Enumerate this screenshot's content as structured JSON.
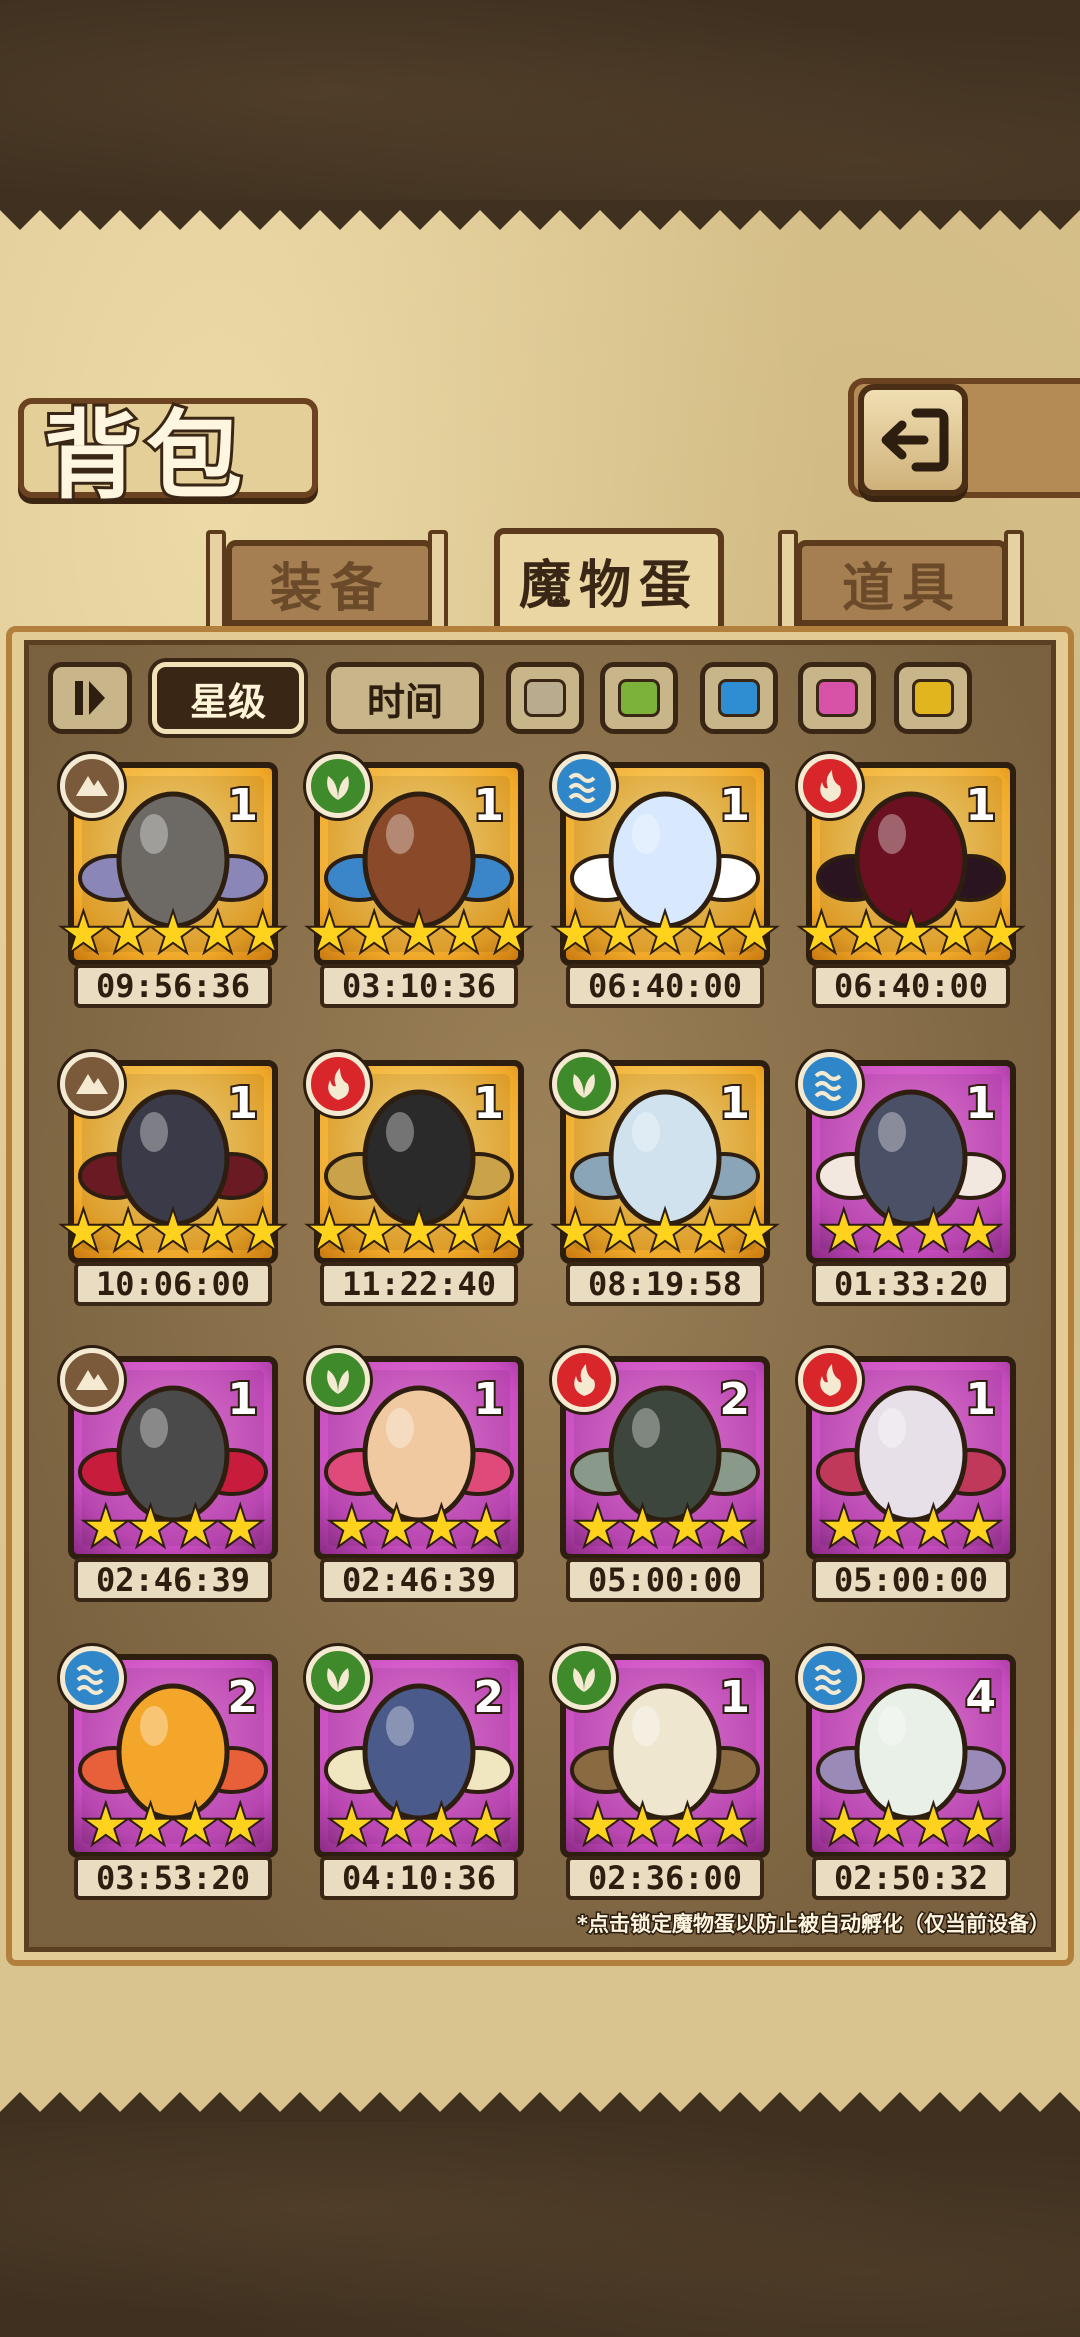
{
  "header": {
    "title": "背包"
  },
  "tabs": [
    {
      "label": "装备",
      "active": false
    },
    {
      "label": "魔物蛋",
      "active": true
    },
    {
      "label": "道具",
      "active": false
    }
  ],
  "filters": {
    "sort_icon": "sort-toggle-icon",
    "star_label": "星级",
    "time_label": "时间",
    "color_filters": [
      "#b9ab8e",
      "#7db23a",
      "#2f8ed1",
      "#d653a8",
      "#e0b51e"
    ]
  },
  "eggs": [
    {
      "element": "earth",
      "count": "1",
      "stars": 5,
      "rarity": "gold",
      "timer": "09:56:36",
      "art": "rock-egg"
    },
    {
      "element": "grass",
      "count": "1",
      "stars": 5,
      "rarity": "gold",
      "timer": "03:10:36",
      "art": "bat-egg"
    },
    {
      "element": "water",
      "count": "1",
      "stars": 5,
      "rarity": "gold",
      "timer": "06:40:00",
      "art": "angel-egg"
    },
    {
      "element": "fire",
      "count": "1",
      "stars": 5,
      "rarity": "gold",
      "timer": "06:40:00",
      "art": "demon-egg"
    },
    {
      "element": "earth",
      "count": "1",
      "stars": 5,
      "rarity": "gold",
      "timer": "10:06:00",
      "art": "coffin-egg"
    },
    {
      "element": "fire",
      "count": "1",
      "stars": 5,
      "rarity": "gold",
      "timer": "11:22:40",
      "art": "pirate-hat-egg"
    },
    {
      "element": "grass",
      "count": "1",
      "stars": 5,
      "rarity": "gold",
      "timer": "08:19:58",
      "art": "pocket-watch-egg"
    },
    {
      "element": "water",
      "count": "1",
      "stars": 4,
      "rarity": "purple",
      "timer": "01:33:20",
      "art": "drill-shell-egg"
    },
    {
      "element": "earth",
      "count": "1",
      "stars": 4,
      "rarity": "purple",
      "timer": "02:46:39",
      "art": "gear-egg"
    },
    {
      "element": "grass",
      "count": "1",
      "stars": 4,
      "rarity": "purple",
      "timer": "02:46:39",
      "art": "feather-egg"
    },
    {
      "element": "fire",
      "count": "2",
      "stars": 4,
      "rarity": "purple",
      "timer": "05:00:00",
      "art": "hammer-dark-egg"
    },
    {
      "element": "fire",
      "count": "1",
      "stars": 4,
      "rarity": "purple",
      "timer": "05:00:00",
      "art": "hammer-light-egg"
    },
    {
      "element": "water",
      "count": "2",
      "stars": 4,
      "rarity": "purple",
      "timer": "03:53:20",
      "art": "jelly-egg"
    },
    {
      "element": "grass",
      "count": "2",
      "stars": 4,
      "rarity": "purple",
      "timer": "04:10:36",
      "art": "sword-egg"
    },
    {
      "element": "grass",
      "count": "1",
      "stars": 4,
      "rarity": "purple",
      "timer": "02:36:00",
      "art": "nest-egg"
    },
    {
      "element": "water",
      "count": "4",
      "stars": 4,
      "rarity": "purple",
      "timer": "02:50:32",
      "art": "leaf-egg"
    }
  ],
  "footnote": "*点击锁定魔物蛋以防止被自动孵化（仅当前设备）"
}
